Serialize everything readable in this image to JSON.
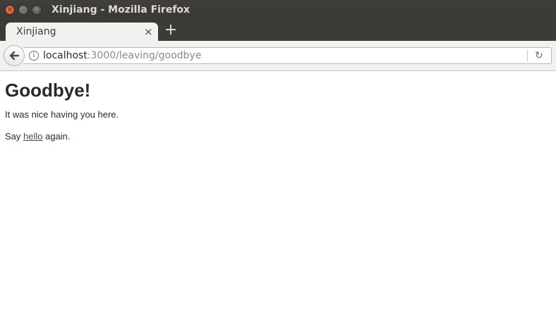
{
  "window": {
    "title": "Xinjiang - Mozilla Firefox",
    "close_glyph": "×",
    "min_glyph": "–",
    "max_glyph": "□"
  },
  "tabs": [
    {
      "label": "Xinjiang",
      "active": true,
      "close_glyph": "×"
    }
  ],
  "new_tab_glyph": "+",
  "nav": {
    "back_icon": "arrow-left-icon",
    "info_icon": "info-icon",
    "info_glyph": "i",
    "url_host": "localhost",
    "url_rest": ":3000/leaving/goodbye",
    "reload_icon": "reload-icon",
    "reload_glyph": "↻"
  },
  "page": {
    "heading": "Goodbye!",
    "line1": "It was nice having you here.",
    "line2_before": "Say ",
    "line2_link": "hello",
    "line2_after": " again."
  },
  "colors": {
    "titlebar": "#3c3b37",
    "close_button": "#e95420",
    "toolbar": "#f2f1f0",
    "page_bg": "#ffffff"
  }
}
